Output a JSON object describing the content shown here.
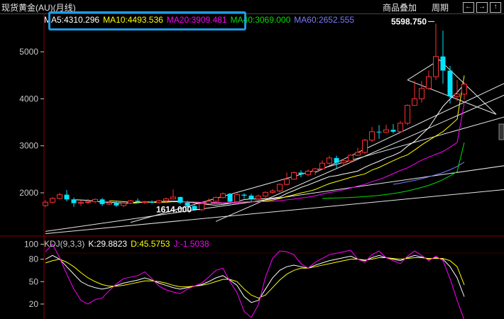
{
  "window": {
    "title": "现货黄金(AU)(月线)",
    "overlay_button": "商品叠加",
    "period_button": "周期",
    "nav_icons": [
      "arrow-left-icon",
      "arrow-right-icon",
      "arrow-up-icon"
    ]
  },
  "ma_legend": [
    {
      "label": "MA5:4310.296",
      "color": "#ffffff"
    },
    {
      "label": "MA10:4493.536",
      "color": "#ffff00"
    },
    {
      "label": "MA20:3909.481",
      "color": "#ff00ff"
    },
    {
      "label": "MA40:3069.000",
      "color": "#00e000"
    },
    {
      "label": "MA60:2652.555",
      "color": "#7a7aff"
    }
  ],
  "kdj_legend": {
    "name": "KDJ(9,3,3)",
    "k": "K:29.8823",
    "d": "D:45.5753",
    "j": "J:-1.5038"
  },
  "colors": {
    "up": "#ff3030",
    "down": "#00e5ff",
    "grid": "#8b0000",
    "axis_text": "#c8c8c8",
    "highlight": "#1e9be6"
  },
  "chart_data": [
    {
      "type": "candlestick",
      "title": "现货黄金(AU)(月线)",
      "y_ticks": [
        2000,
        3000,
        4000,
        5000
      ],
      "ylim": [
        1080,
        5800
      ],
      "annotations": [
        {
          "text": "5598.750",
          "marks": "high"
        },
        {
          "text": "1614.000",
          "marks": "low"
        }
      ],
      "ohlc": [
        [
          1730,
          1850,
          1690,
          1800
        ],
        [
          1800,
          1910,
          1780,
          1880
        ],
        [
          1880,
          2000,
          1860,
          1960
        ],
        [
          1960,
          2060,
          1820,
          1860
        ],
        [
          1860,
          1900,
          1700,
          1780
        ],
        [
          1780,
          1840,
          1720,
          1800
        ],
        [
          1800,
          1870,
          1760,
          1810
        ],
        [
          1810,
          1880,
          1780,
          1860
        ],
        [
          1860,
          1890,
          1720,
          1760
        ],
        [
          1760,
          1830,
          1740,
          1790
        ],
        [
          1790,
          1820,
          1700,
          1730
        ],
        [
          1730,
          1800,
          1700,
          1780
        ],
        [
          1780,
          1850,
          1760,
          1830
        ],
        [
          1830,
          1880,
          1780,
          1800
        ],
        [
          1800,
          1830,
          1760,
          1810
        ],
        [
          1810,
          1840,
          1780,
          1790
        ],
        [
          1790,
          1850,
          1770,
          1830
        ],
        [
          1830,
          1900,
          1800,
          1870
        ],
        [
          1870,
          2070,
          1860,
          1910
        ],
        [
          1910,
          1920,
          1760,
          1790
        ],
        [
          1790,
          1830,
          1690,
          1720
        ],
        [
          1720,
          1740,
          1620,
          1640
        ],
        [
          1640,
          1780,
          1614,
          1770
        ],
        [
          1770,
          1880,
          1760,
          1820
        ],
        [
          1820,
          1920,
          1800,
          1900
        ],
        [
          1900,
          2010,
          1880,
          1980
        ],
        [
          1980,
          2000,
          1800,
          1810
        ],
        [
          1810,
          1990,
          1800,
          1960
        ],
        [
          1960,
          1990,
          1880,
          1940
        ],
        [
          1940,
          1980,
          1810,
          1870
        ],
        [
          1870,
          1960,
          1860,
          1930
        ],
        [
          1930,
          2030,
          1900,
          2010
        ],
        [
          2010,
          2080,
          1980,
          2040
        ],
        [
          2040,
          2200,
          2010,
          2180
        ],
        [
          2180,
          2430,
          2160,
          2290
        ],
        [
          2290,
          2450,
          2280,
          2430
        ],
        [
          2430,
          2480,
          2330,
          2390
        ],
        [
          2390,
          2500,
          2350,
          2460
        ],
        [
          2460,
          2530,
          2380,
          2510
        ],
        [
          2510,
          2690,
          2490,
          2630
        ],
        [
          2630,
          2790,
          2600,
          2740
        ],
        [
          2740,
          2790,
          2530,
          2640
        ],
        [
          2640,
          2720,
          2590,
          2680
        ],
        [
          2680,
          2820,
          2640,
          2800
        ],
        [
          2800,
          2960,
          2780,
          2860
        ],
        [
          2860,
          3150,
          2830,
          3120
        ],
        [
          3120,
          3400,
          3080,
          3300
        ],
        [
          3300,
          3440,
          3150,
          3290
        ],
        [
          3290,
          3450,
          3280,
          3340
        ],
        [
          3340,
          3460,
          3260,
          3300
        ],
        [
          3300,
          3530,
          3280,
          3480
        ],
        [
          3480,
          3880,
          3440,
          3860
        ],
        [
          3860,
          4380,
          3850,
          4000
        ],
        [
          4000,
          4380,
          3920,
          4220
        ],
        [
          4220,
          4600,
          4190,
          4470
        ],
        [
          4470,
          5598.75,
          4400,
          4900
        ],
        [
          4900,
          5450,
          4320,
          4600
        ],
        [
          4600,
          4700,
          3900,
          4050
        ],
        [
          4050,
          4400,
          3950,
          4100
        ],
        [
          4100,
          4350,
          3980,
          4310
        ]
      ],
      "ma": {
        "MA5": [
          null,
          null,
          null,
          null,
          1852,
          1848,
          1840,
          1822,
          1802,
          1802,
          1788,
          1784,
          1779,
          1786,
          1807,
          1804,
          1812,
          1820,
          1820,
          1821,
          1804,
          1786,
          1769,
          1749,
          1738,
          1752,
          1778,
          1816,
          1856,
          1872,
          1866,
          1875,
          1887,
          1909,
          1988,
          2047,
          2114,
          2167,
          2227,
          2286,
          2344,
          2365,
          2400,
          2429,
          2462,
          2542,
          2612,
          2671,
          2742,
          2796,
          2865,
          2992,
          3094,
          3241,
          3384,
          3612,
          3839,
          3998,
          4136,
          4310
        ],
        "MA10": [
          null,
          null,
          null,
          null,
          null,
          null,
          null,
          null,
          null,
          1830,
          1823,
          1813,
          1800,
          1794,
          1807,
          1794,
          1798,
          1800,
          1811,
          1809,
          1808,
          1801,
          1792,
          1785,
          1780,
          1778,
          1782,
          1792,
          1803,
          1811,
          1810,
          1826,
          1846,
          1879,
          1921,
          1957,
          1996,
          2029,
          2070,
          2135,
          2196,
          2239,
          2283,
          2328,
          2367,
          2402,
          2483,
          2539,
          2611,
          2683,
          2751,
          2807,
          2909,
          3019,
          3115,
          3210,
          3301,
          3430,
          3567,
          4494
        ],
        "MA20": [
          null,
          null,
          null,
          null,
          null,
          null,
          null,
          null,
          null,
          null,
          null,
          null,
          null,
          null,
          null,
          null,
          null,
          null,
          null,
          1810,
          1810,
          1805,
          1799,
          1796,
          1794,
          1786,
          1790,
          1796,
          1807,
          1810,
          1809,
          1813,
          1819,
          1832,
          1850,
          1866,
          1889,
          1910,
          1936,
          1973,
          2005,
          2033,
          2065,
          2101,
          2143,
          2180,
          2238,
          2284,
          2341,
          2409,
          2475,
          2530,
          2612,
          2694,
          2760,
          2818,
          2880,
          2970,
          3070,
          3909
        ],
        "MA40": [
          null,
          null,
          null,
          null,
          null,
          null,
          null,
          null,
          null,
          null,
          null,
          null,
          null,
          null,
          null,
          null,
          null,
          null,
          null,
          null,
          null,
          null,
          null,
          null,
          null,
          null,
          null,
          null,
          null,
          null,
          null,
          null,
          null,
          null,
          null,
          null,
          null,
          null,
          null,
          1880,
          1886,
          1890,
          1895,
          1902,
          1910,
          1920,
          1932,
          1946,
          1964,
          1985,
          2010,
          2040,
          2075,
          2115,
          2160,
          2215,
          2280,
          2360,
          2450,
          3069
        ],
        "MA60": [
          null,
          null,
          null,
          null,
          null,
          null,
          null,
          null,
          null,
          null,
          null,
          null,
          null,
          null,
          null,
          null,
          null,
          null,
          null,
          null,
          null,
          null,
          null,
          null,
          null,
          null,
          null,
          null,
          null,
          null,
          null,
          null,
          null,
          null,
          null,
          null,
          null,
          null,
          null,
          null,
          null,
          null,
          null,
          null,
          null,
          null,
          null,
          null,
          null,
          2180,
          2205,
          2235,
          2265,
          2300,
          2340,
          2385,
          2430,
          2490,
          2560,
          2653
        ]
      }
    },
    {
      "type": "line",
      "title": "KDJ(9,3,3)",
      "y_ticks": [
        20,
        50,
        80,
        100
      ],
      "ylim": [
        0,
        110
      ],
      "series": [
        {
          "name": "K",
          "values": [
            80,
            85,
            80,
            70,
            60,
            50,
            45,
            42,
            40,
            42,
            45,
            48,
            50,
            52,
            55,
            52,
            48,
            45,
            42,
            40,
            42,
            44,
            46,
            50,
            55,
            58,
            52,
            45,
            30,
            22,
            25,
            40,
            55,
            65,
            70,
            72,
            70,
            68,
            72,
            75,
            78,
            80,
            82,
            84,
            80,
            78,
            82,
            85,
            82,
            80,
            78,
            82,
            85,
            83,
            80,
            82,
            80,
            70,
            55,
            29.88
          ]
        },
        {
          "name": "D",
          "values": [
            75,
            78,
            80,
            76,
            70,
            62,
            55,
            50,
            46,
            44,
            44,
            45,
            47,
            49,
            51,
            51,
            50,
            48,
            45,
            43,
            43,
            44,
            45,
            47,
            50,
            53,
            53,
            50,
            40,
            32,
            28,
            32,
            42,
            52,
            60,
            65,
            68,
            68,
            70,
            72,
            74,
            76,
            78,
            80,
            80,
            79,
            80,
            82,
            82,
            81,
            80,
            81,
            82,
            82,
            81,
            81,
            81,
            78,
            70,
            45.58
          ]
        },
        {
          "name": "J",
          "values": [
            90,
            100,
            82,
            60,
            40,
            25,
            20,
            26,
            28,
            38,
            47,
            54,
            56,
            58,
            63,
            54,
            44,
            39,
            36,
            34,
            40,
            44,
            48,
            56,
            65,
            68,
            50,
            35,
            10,
            2,
            19,
            56,
            81,
            91,
            90,
            86,
            74,
            68,
            76,
            81,
            86,
            88,
            90,
            92,
            80,
            76,
            86,
            91,
            82,
            78,
            74,
            84,
            91,
            85,
            78,
            84,
            78,
            54,
            25,
            -1.5
          ]
        }
      ]
    }
  ]
}
